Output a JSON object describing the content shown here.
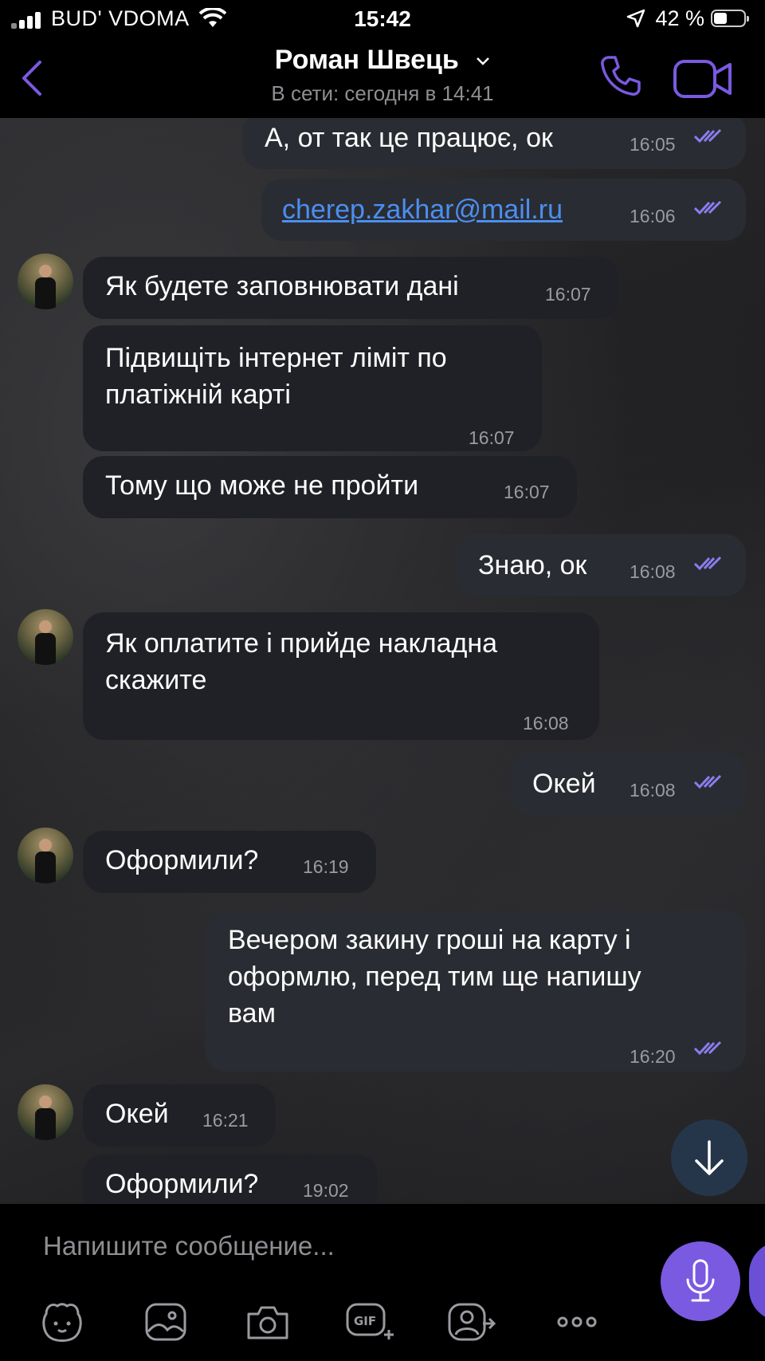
{
  "status_bar": {
    "carrier": "BUD' VDOMA",
    "time": "15:42",
    "battery_percent": "42 %"
  },
  "header": {
    "contact_name": "Роман Швець",
    "last_seen": "В сети: сегодня в 14:41"
  },
  "messages": [
    {
      "direction": "out",
      "text": "А, от так це працює, ок",
      "time": "16:05",
      "read": true
    },
    {
      "direction": "out",
      "text": "cherep.zakhar@mail.ru",
      "time": "16:06",
      "read": true,
      "is_link": true
    },
    {
      "direction": "in",
      "text": "Як будете заповнювати дані",
      "time": "16:07"
    },
    {
      "direction": "in",
      "lines": [
        "Підвищіть інтернет ліміт по",
        "платіжній карті"
      ],
      "time": "16:07"
    },
    {
      "direction": "in",
      "text": "Тому що може не пройти",
      "time": "16:07"
    },
    {
      "direction": "out",
      "text": "Знаю, ок",
      "time": "16:08",
      "read": true
    },
    {
      "direction": "in",
      "lines": [
        "Як оплатите і прийде накладна",
        "скажите"
      ],
      "time": "16:08"
    },
    {
      "direction": "out",
      "text": "Окей",
      "time": "16:08",
      "read": true
    },
    {
      "direction": "in",
      "text": "Оформили?",
      "time": "16:19"
    },
    {
      "direction": "out",
      "lines": [
        "Вечером закину гроші на карту і",
        "оформлю, перед тим ще напишу",
        "вам"
      ],
      "time": "16:20",
      "read": true
    },
    {
      "direction": "in",
      "text": "Окей",
      "time": "16:21"
    },
    {
      "direction": "in",
      "text": "Оформили?",
      "time": "19:02"
    }
  ],
  "composer": {
    "placeholder": "Напишите сообщение..."
  },
  "toolbar_icons": [
    "sticker-icon",
    "gallery-icon",
    "camera-icon",
    "gif-icon",
    "share-contact-icon",
    "more-icon"
  ],
  "colors": {
    "accent": "#7a5ae0",
    "bubble_in": "#202126",
    "bubble_out": "#2a2c33",
    "link": "#4a8ff0",
    "read_ticks": "#8d7cf0"
  }
}
